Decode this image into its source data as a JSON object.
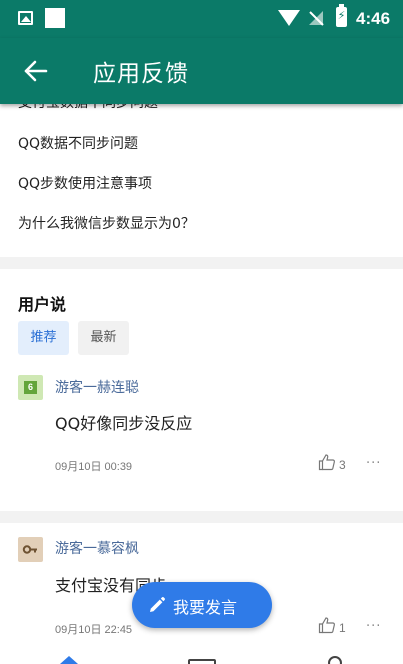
{
  "status_bar": {
    "time": "4:46",
    "icons": [
      "image-icon",
      "square-icon",
      "wifi-icon",
      "no-signal-icon",
      "battery-charging-icon"
    ]
  },
  "app_bar": {
    "title": "应用反馈",
    "back_icon": "arrow-left-icon",
    "background": "#0b7a68"
  },
  "faq": {
    "partial_item": "支付宝数据不同步问题",
    "items": [
      "QQ数据不同步问题",
      "QQ步数使用注意事项",
      "为什么我微信步数显示为0？"
    ]
  },
  "user_says": {
    "title": "用户说",
    "tabs": [
      {
        "label": "推荐",
        "active": true
      },
      {
        "label": "最新",
        "active": false
      }
    ],
    "posts": [
      {
        "user": "游客一赫连聪",
        "avatar_icon": "green-badge-avatar-icon",
        "content": "QQ好像同步没反应",
        "time": "09月10日 00:39",
        "likes": "3",
        "more": "···"
      },
      {
        "user": "游客一慕容枫",
        "avatar_icon": "key-avatar-icon",
        "content": "支付宝没有同步",
        "time": "09月10日 22:45",
        "likes": "1",
        "more": "···"
      }
    ]
  },
  "fab": {
    "label": "我要发言",
    "icon": "pencil-icon",
    "color": "#2f7be8"
  },
  "bottom_nav": {
    "icons": [
      "home-icon",
      "message-icon",
      "profile-icon"
    ]
  }
}
